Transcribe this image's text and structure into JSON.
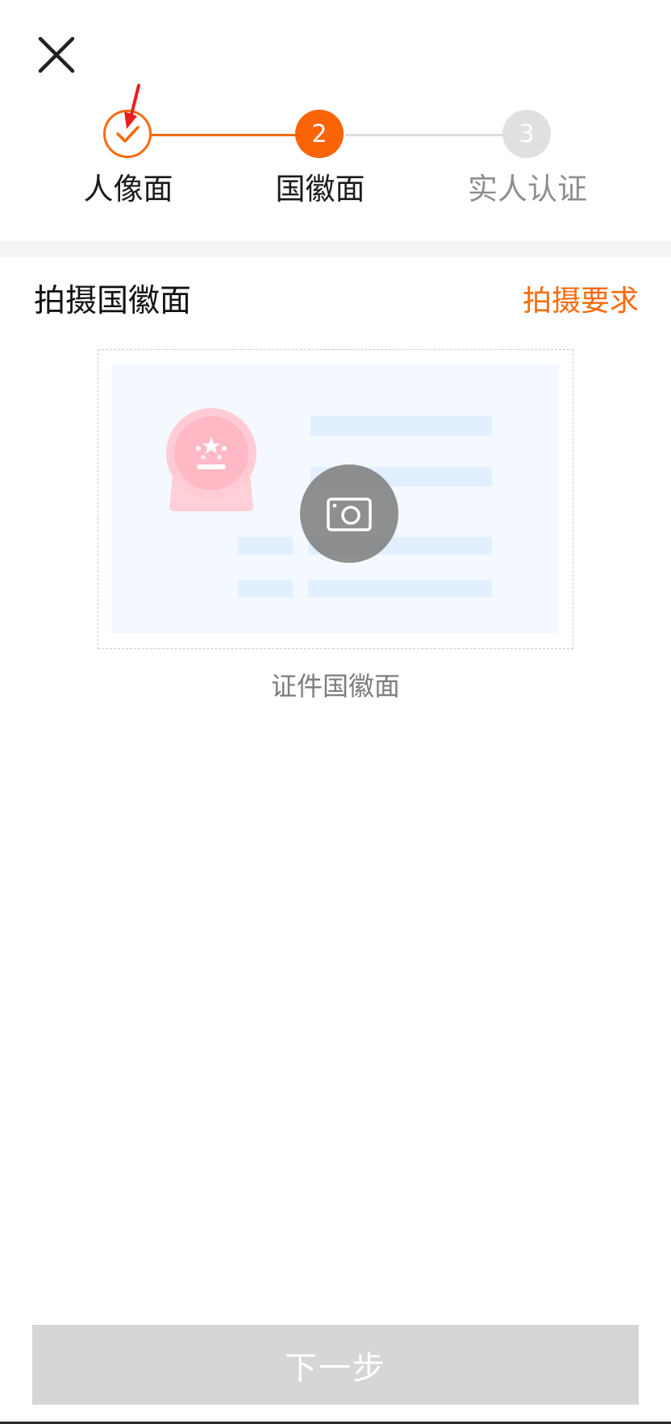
{
  "header": {
    "close_icon": "close-icon"
  },
  "stepper": {
    "steps": [
      {
        "label": "人像面",
        "state": "done",
        "icon": "check-icon"
      },
      {
        "label": "国徽面",
        "state": "active",
        "number": "2"
      },
      {
        "label": "实人认证",
        "state": "todo",
        "number": "3"
      }
    ],
    "accent_color": "#F96A0E",
    "inactive_color": "#E0E0E0"
  },
  "section": {
    "title": "拍摄国徽面",
    "requirements_link": "拍摄要求"
  },
  "capture": {
    "caption": "证件国徽面",
    "camera_icon": "camera-icon",
    "illustration": "id-card-emblem-side"
  },
  "footer": {
    "next_label": "下一步"
  }
}
